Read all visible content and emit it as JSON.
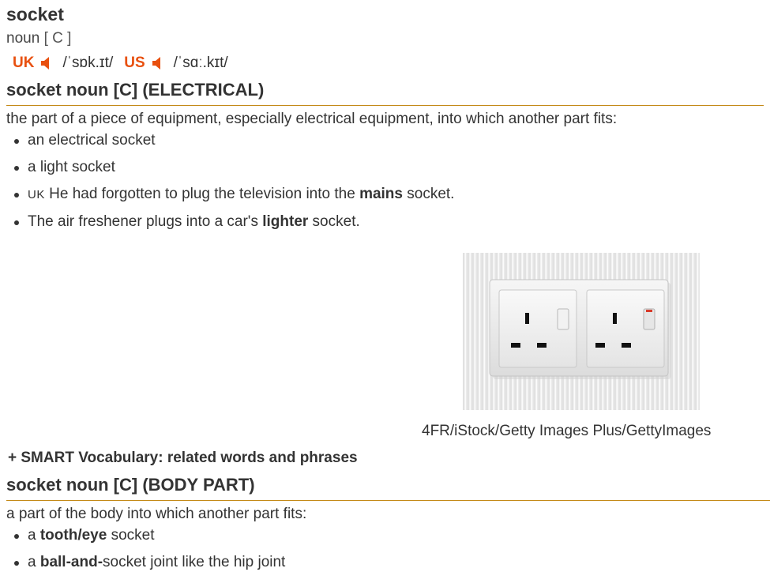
{
  "entry": {
    "headword": "socket",
    "pos": "noun",
    "grammar": "[ C ]",
    "pron": {
      "uk_label": "UK",
      "uk_ipa": "/ˈsɒk.ɪt/",
      "us_label": "US",
      "us_ipa": "/ˈsɑː.kɪt/"
    }
  },
  "sense1": {
    "title": "socket noun [C] (ELECTRICAL)",
    "definition": "the part of a piece of equipment, especially electrical equipment, into which another part fits:",
    "examples": [
      {
        "text": "an electrical socket"
      },
      {
        "text": "a light socket"
      },
      {
        "label": "UK",
        "pre": " He had forgotten to plug the television into the ",
        "bold": "mains",
        "post": " socket."
      },
      {
        "pre": "The air freshener plugs into a car's ",
        "bold": "lighter",
        "post": " socket."
      }
    ],
    "image_caption": "4FR/iStock/Getty Images Plus/GettyImages"
  },
  "smart_vocab": "+ SMART Vocabulary: related words and phrases",
  "sense2": {
    "title": "socket noun [C] (BODY PART)",
    "definition": "a part of the body into which another part fits:",
    "examples": [
      {
        "pre": "a ",
        "bold": "tooth/eye",
        "post": " socket"
      },
      {
        "pre": "a ",
        "bold": "ball-and-",
        "post": "socket joint like the hip joint"
      }
    ]
  },
  "colors": {
    "accent_orange": "#e8500f",
    "rule_gold": "#c48a18",
    "text": "#333333"
  },
  "icons": [
    "speaker-icon"
  ]
}
